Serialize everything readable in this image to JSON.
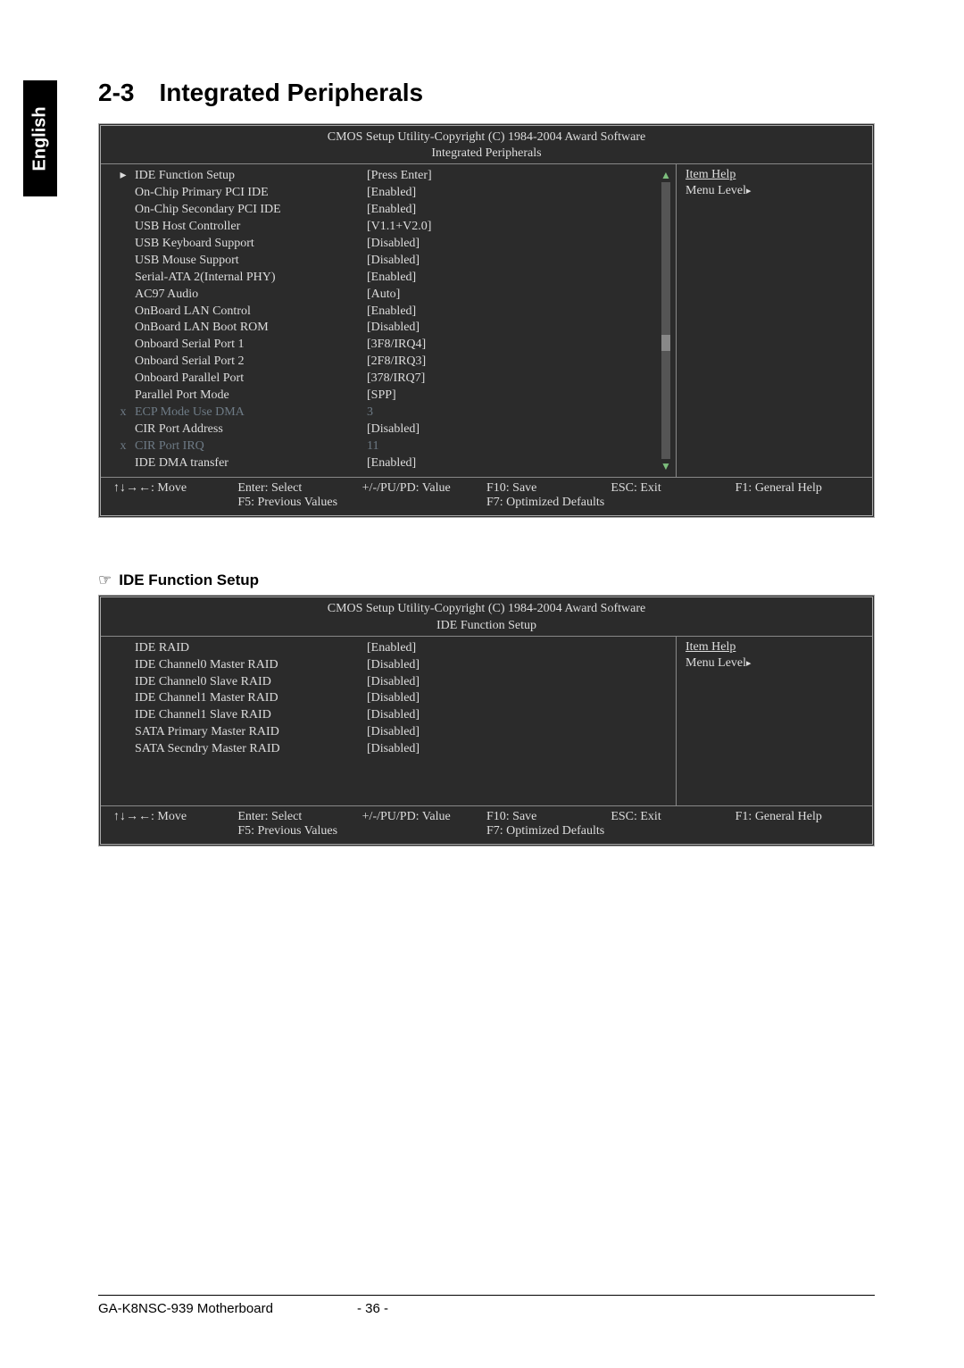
{
  "side_tab": "English",
  "section": {
    "number": "2-3",
    "title": "Integrated Peripherals"
  },
  "bios1": {
    "header_line1": "CMOS Setup Utility-Copyright (C) 1984-2004 Award Software",
    "header_line2": "Integrated Peripherals",
    "help": {
      "title": "Item Help",
      "level": "Menu Level",
      "arrow": "▸"
    },
    "rows": [
      {
        "mark": "▸",
        "label": "IDE Function Setup",
        "value": "[Press Enter]"
      },
      {
        "mark": "",
        "label": "On-Chip Primary PCI IDE",
        "value": "[Enabled]"
      },
      {
        "mark": "",
        "label": "On-Chip Secondary PCI IDE",
        "value": "[Enabled]"
      },
      {
        "mark": "",
        "label": "USB Host Controller",
        "value": "[V1.1+V2.0]"
      },
      {
        "mark": "",
        "label": "USB Keyboard Support",
        "value": "[Disabled]"
      },
      {
        "mark": "",
        "label": "USB Mouse Support",
        "value": "[Disabled]"
      },
      {
        "mark": "",
        "label": "Serial-ATA 2(Internal PHY)",
        "value": "[Enabled]"
      },
      {
        "mark": "",
        "label": "AC97 Audio",
        "value": "[Auto]"
      },
      {
        "mark": "",
        "label": "OnBoard LAN Control",
        "value": "[Enabled]"
      },
      {
        "mark": "",
        "label": "OnBoard LAN Boot ROM",
        "value": "[Disabled]"
      },
      {
        "mark": "",
        "label": "Onboard Serial Port 1",
        "value": "[3F8/IRQ4]"
      },
      {
        "mark": "",
        "label": "Onboard Serial Port 2",
        "value": "[2F8/IRQ3]"
      },
      {
        "mark": "",
        "label": "Onboard Parallel Port",
        "value": "[378/IRQ7]"
      },
      {
        "mark": "",
        "label": "Parallel Port Mode",
        "value": "[SPP]"
      },
      {
        "mark": "x",
        "label": "ECP Mode Use DMA",
        "value": "3",
        "dim": true
      },
      {
        "mark": "",
        "label": "CIR Port Address",
        "value": "[Disabled]"
      },
      {
        "mark": "x",
        "label": "CIR Port IRQ",
        "value": "11",
        "dim": true
      },
      {
        "mark": "",
        "label": "IDE DMA transfer",
        "value": "[Enabled]"
      }
    ],
    "footer": {
      "r1": [
        "↑↓→←: Move",
        "Enter: Select",
        "+/-/PU/PD: Value",
        "F10: Save",
        "ESC: Exit",
        "F1: General Help"
      ],
      "r2": [
        "",
        "F5: Previous Values",
        "",
        "F7: Optimized Defaults",
        "",
        ""
      ]
    }
  },
  "sub_heading": "IDE Function Setup",
  "hand": "☞",
  "bios2": {
    "header_line1": "CMOS Setup Utility-Copyright (C) 1984-2004 Award Software",
    "header_line2": "IDE Function Setup",
    "help": {
      "title": "Item Help",
      "level": "Menu Level",
      "arrow": "▸"
    },
    "rows": [
      {
        "mark": "",
        "label": "IDE RAID",
        "value": "[Enabled]"
      },
      {
        "mark": "",
        "label": "IDE Channel0 Master RAID",
        "value": "[Disabled]"
      },
      {
        "mark": "",
        "label": "IDE Channel0 Slave RAID",
        "value": "[Disabled]"
      },
      {
        "mark": "",
        "label": "IDE Channel1 Master RAID",
        "value": "[Disabled]"
      },
      {
        "mark": "",
        "label": "IDE Channel1 Slave RAID",
        "value": "[Disabled]"
      },
      {
        "mark": "",
        "label": "SATA Primary Master RAID",
        "value": "[Disabled]"
      },
      {
        "mark": "",
        "label": "SATA Secndry Master RAID",
        "value": "[Disabled]"
      }
    ],
    "footer": {
      "r1": [
        "↑↓→←: Move",
        "Enter: Select",
        "+/-/PU/PD: Value",
        "F10: Save",
        "ESC: Exit",
        "F1: General Help"
      ],
      "r2": [
        "",
        "F5: Previous Values",
        "",
        "F7: Optimized Defaults",
        "",
        ""
      ]
    }
  },
  "page_footer": {
    "model": "GA-K8NSC-939 Motherboard",
    "page": "- 36 -"
  }
}
